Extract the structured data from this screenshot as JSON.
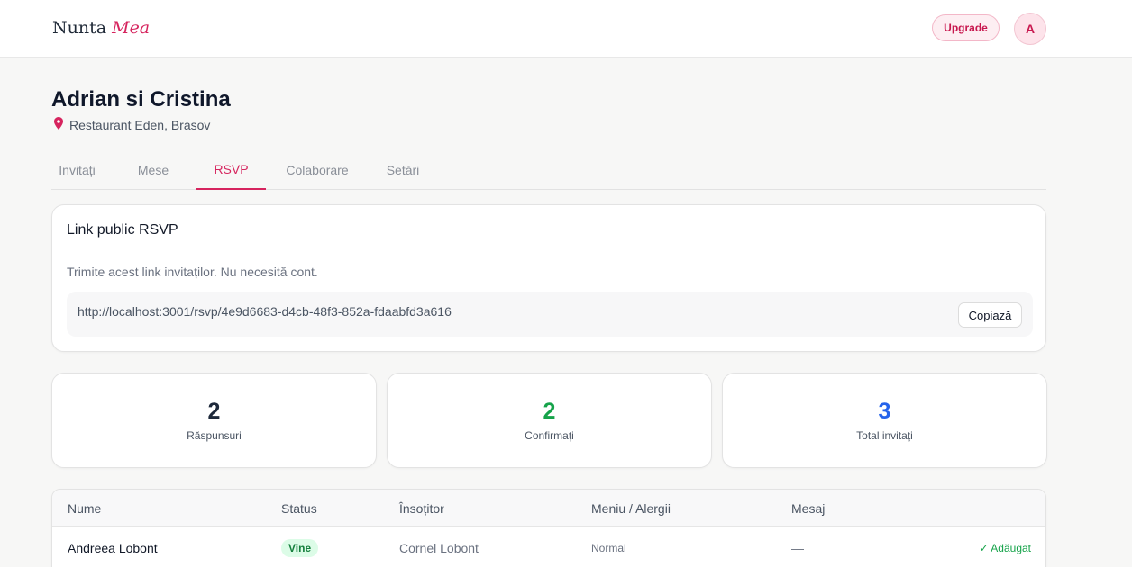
{
  "header": {
    "logo_primary": "Nunta",
    "logo_accent": "Mea",
    "upgrade_label": "Upgrade",
    "avatar_initial": "A"
  },
  "event": {
    "title": "Adrian si Cristina",
    "location": "Restaurant Eden, Brasov",
    "location_icon": "map-pin-icon"
  },
  "tabs": [
    {
      "label": "Invitați",
      "active": false
    },
    {
      "label": "Mese",
      "active": false
    },
    {
      "label": "RSVP",
      "active": true
    },
    {
      "label": "Colaborare",
      "active": false
    },
    {
      "label": "Setări",
      "active": false
    }
  ],
  "rsvp_link": {
    "title": "Link public RSVP",
    "description": "Trimite acest link invitaților. Nu necesită cont.",
    "url": "http://localhost:3001/rsvp/4e9d6683-d4cb-48f3-852a-fdaabfd3a616",
    "copy_label": "Copiază"
  },
  "stats": [
    {
      "value": "2",
      "label": "Răspunsuri",
      "color": "#1e293b"
    },
    {
      "value": "2",
      "label": "Confirmați",
      "color": "#16a34a"
    },
    {
      "value": "3",
      "label": "Total invitați",
      "color": "#2563eb"
    }
  ],
  "table": {
    "columns": [
      "Nume",
      "Status",
      "Însoțitor",
      "Meniu / Alergii",
      "Mesaj"
    ],
    "rows": [
      {
        "name": "Andreea Lobont",
        "status": "Vine",
        "companion": "Cornel Lobont",
        "menu": "Normal",
        "message": "—",
        "action": "✓ Adăugat"
      }
    ]
  },
  "colors": {
    "accent": "#d6245e",
    "status_success": "#16a34a"
  }
}
